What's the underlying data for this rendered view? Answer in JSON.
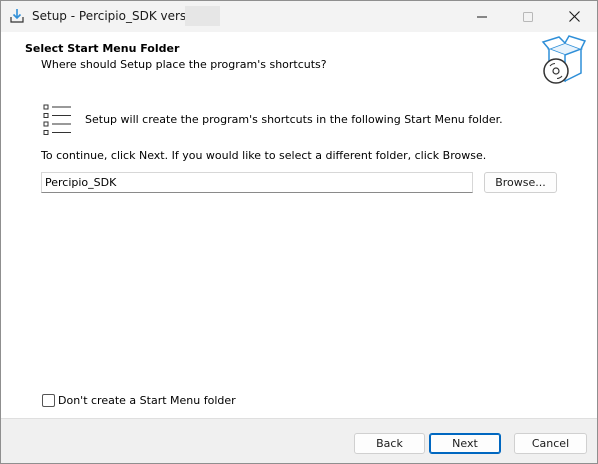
{
  "window": {
    "title": "Setup - Percipio_SDK version",
    "controls": {
      "minimize_icon": "minimize-icon",
      "maximize_icon": "maximize-icon",
      "close_icon": "close-icon"
    }
  },
  "header": {
    "title": "Select Start Menu Folder",
    "subtitle": "Where should Setup place the program's shortcuts?",
    "icon": "setup-box-icon"
  },
  "content": {
    "info_text": "Setup will create the program's shortcuts in the following Start Menu folder.",
    "continue_text": "To continue, click Next. If you would like to select a different folder, click Browse.",
    "folder_value": "Percipio_SDK",
    "browse_label": "Browse...",
    "no_folder_label": "Don't create a Start Menu folder",
    "no_folder_checked": false
  },
  "footer": {
    "back_label": "Back",
    "next_label": "Next",
    "cancel_label": "Cancel"
  },
  "colors": {
    "accent": "#0067c0",
    "icon_blue": "#2f8fd8"
  }
}
